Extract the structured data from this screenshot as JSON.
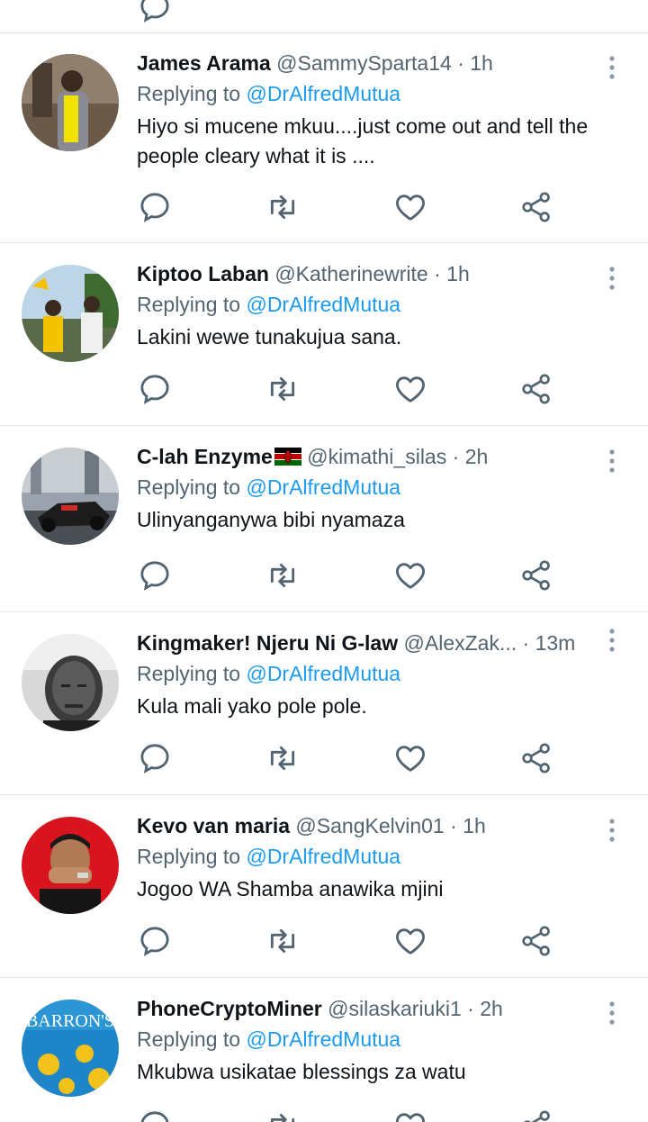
{
  "reply_prefix": "Replying to",
  "colors": {
    "text": "#0f1419",
    "secondary": "#536471",
    "link": "#1d9bf0",
    "divider": "#e3e7ea"
  },
  "tweets": [
    {
      "name": "James Arama",
      "handle": "@SammySparta14",
      "time": "1h",
      "mention": "@DrAlfredMutua",
      "text": "Hiyo si mucene mkuu....just come out and tell the people cleary what it is ...."
    },
    {
      "name": "Kiptoo Laban",
      "handle": "@Katherinewrite",
      "time": "1h",
      "mention": "@DrAlfredMutua",
      "text": "Lakini wewe tunakujua sana."
    },
    {
      "name": "C-lah Enzyme",
      "name_emoji": "kenya-flag",
      "handle": "@kimathi_silas",
      "time": "2h",
      "mention": "@DrAlfredMutua",
      "text": "Ulinyanganywa bibi nyamaza"
    },
    {
      "name": "Kingmaker! Njeru Ni G-law",
      "handle": "@AlexZak...",
      "time": "13m",
      "mention": "@DrAlfredMutua",
      "text": "Kula mali yako pole pole."
    },
    {
      "name": "Kevo van maria",
      "handle": "@SangKelvin01",
      "time": "1h",
      "mention": "@DrAlfredMutua",
      "text": "Jogoo WA Shamba anawika mjini"
    },
    {
      "name": "PhoneCryptoMiner",
      "handle": "@silaskariuki1",
      "time": "2h",
      "mention": "@DrAlfredMutua",
      "text": "Mkubwa usikatae blessings za watu",
      "avatar_text": "BARRON'S"
    }
  ],
  "icons": {
    "reply": "reply-icon",
    "retweet": "retweet-icon",
    "like": "heart-icon",
    "share": "share-icon",
    "more": "more-vertical-icon"
  }
}
